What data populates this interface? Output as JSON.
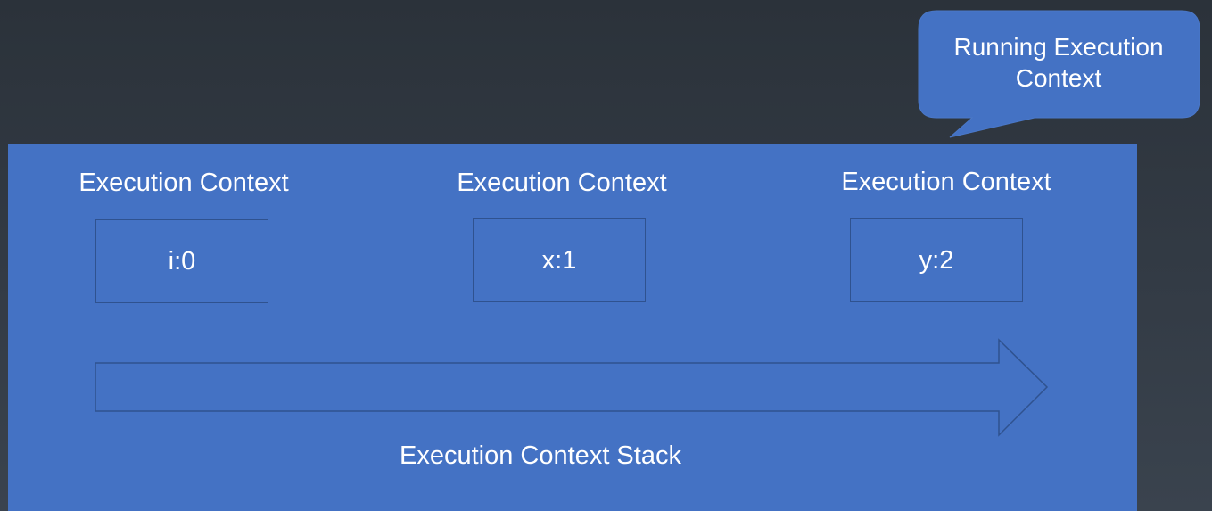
{
  "diagram": {
    "callout": {
      "line1": "Running Execution",
      "line2": "Context"
    },
    "contexts": [
      {
        "title": "Execution Context",
        "value": "i:0"
      },
      {
        "title": "Execution Context",
        "value": "x:1"
      },
      {
        "title": "Execution Context",
        "value": "y:2"
      }
    ],
    "stack_label": "Execution Context Stack"
  },
  "colors": {
    "background": "#2b323a",
    "panel": "#4472c4",
    "border": "#2f528f",
    "text": "#ffffff"
  }
}
